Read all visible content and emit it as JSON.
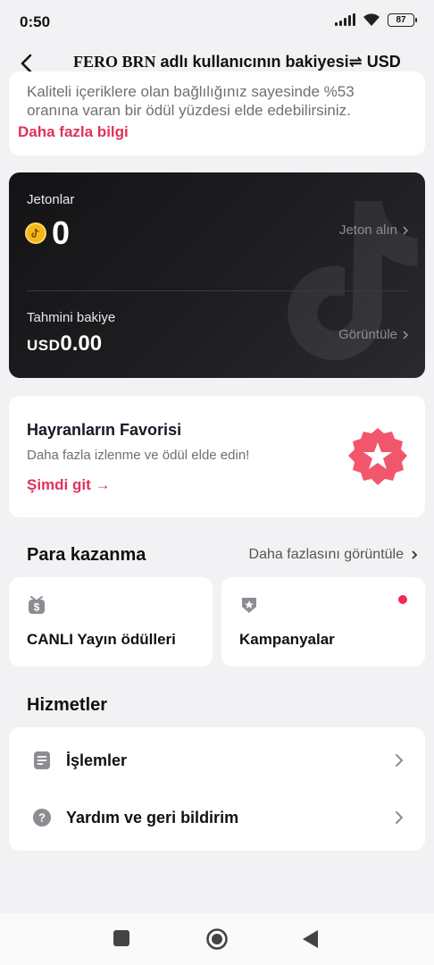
{
  "status_bar": {
    "time": "0:50",
    "battery": "87"
  },
  "header": {
    "title_name": "FERO BRN",
    "title_rest": " adlı kullanıcının bakiyesi",
    "currency_switch": "⇌ USD"
  },
  "info_card": {
    "text": "Kaliteli içeriklere olan bağlılığınız sayesinde %53 oranına varan bir ödül yüzdesi elde edebilirsiniz.",
    "link": "Daha fazla bilgi"
  },
  "balance": {
    "coins_label": "Jetonlar",
    "coins_value": "0",
    "buy_coins": "Jeton alın",
    "estimate_label": "Tahmini bakiye",
    "currency": "USD",
    "amount": "0.00",
    "view": "Görüntüle"
  },
  "fans_favorite": {
    "title": "Hayranların Favorisi",
    "subtitle": "Daha fazla izlenme ve ödül elde edin!",
    "cta": "Şimdi git →"
  },
  "monetization": {
    "title": "Para kazanma",
    "more": "Daha fazlasını görüntüle",
    "items": [
      {
        "label": "CANLI Yayın ödülleri",
        "icon": "dollar-gift-icon"
      },
      {
        "label": "Kampanyalar",
        "icon": "star-shield-icon",
        "has_dot": true
      }
    ]
  },
  "services": {
    "title": "Hizmetler",
    "items": [
      {
        "label": "İşlemler",
        "icon": "document-icon"
      },
      {
        "label": "Yardım ve geri bildirim",
        "icon": "help-icon"
      }
    ]
  },
  "colors": {
    "accent": "#e0325a",
    "card_dark": "#1a1a1c",
    "coin": "#f5b71b",
    "badge": "#f2566b"
  }
}
